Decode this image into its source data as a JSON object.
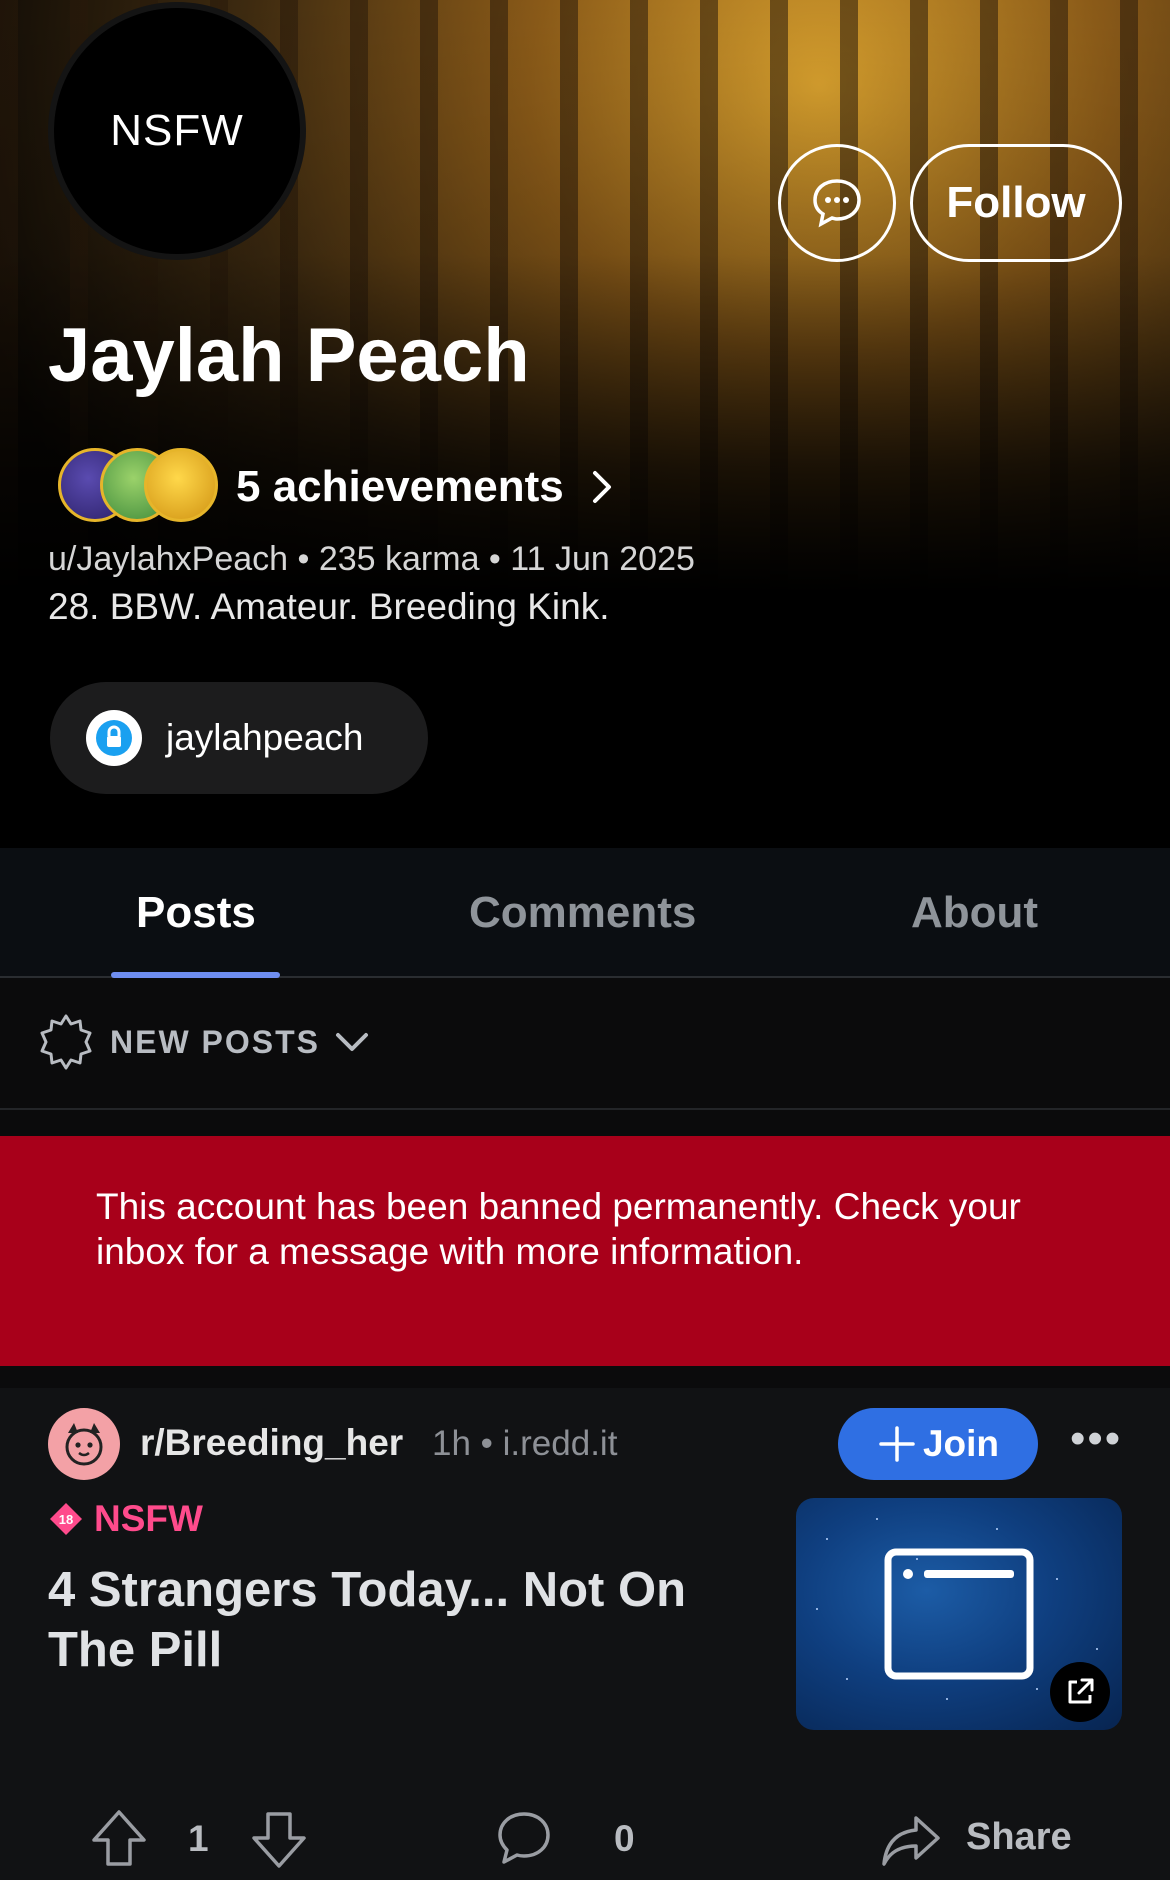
{
  "profile": {
    "avatar_text": "NSFW",
    "name": "Jaylah Peach",
    "follow_label": "Follow",
    "achievements_label": "5 achievements",
    "meta": "u/JaylahxPeach • 235 karma • 11 Jun 2025",
    "bio": "28. BBW. Amateur. Breeding Kink.",
    "social_link": "jaylahpeach",
    "icons": {
      "chat": "chat-bubble-icon",
      "achievements": "achievement-badges-icon",
      "chevron": "chevron-right-icon",
      "social": "lock-icon"
    }
  },
  "tabs": {
    "items": [
      "Posts",
      "Comments",
      "About"
    ],
    "active": "Posts"
  },
  "sort": {
    "label": "NEW POSTS",
    "icon": "sparkle-badge-icon"
  },
  "banner": {
    "text": "This account has been banned permanently. Check your inbox for a message with more information.",
    "color": "#a8001a"
  },
  "post": {
    "subreddit": "r/Breeding_her",
    "time": "1h",
    "domain": "i.redd.it",
    "join_label": "Join",
    "nsfw_label": "NSFW",
    "title": "4 Strangers Today... Not On The Pill",
    "upvotes": "1",
    "comments": "0",
    "share_label": "Share"
  },
  "colors": {
    "accent_tab": "#6f8ef0",
    "join": "#2f6fe3",
    "nsfw": "#ff4b8c"
  }
}
